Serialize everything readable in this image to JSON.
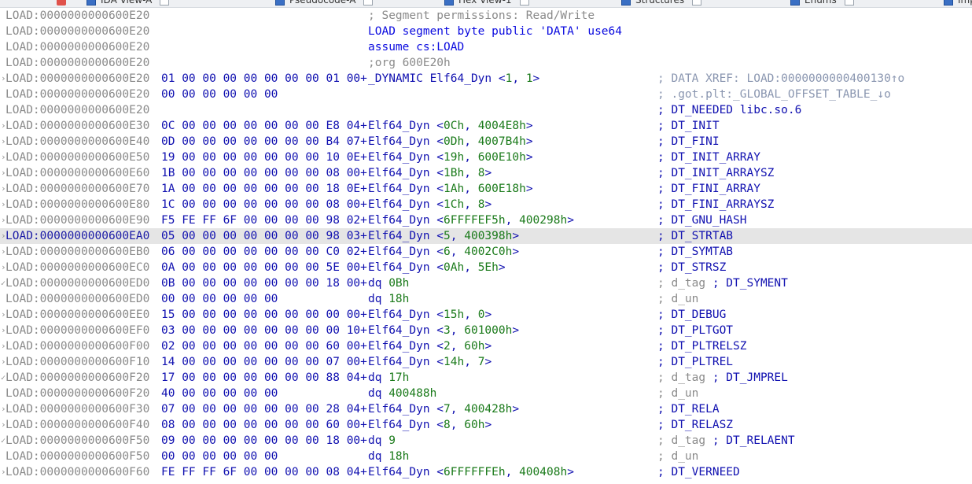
{
  "tabs": [
    {
      "label": "IDA View-A"
    },
    {
      "label": "Pseudocode-A"
    },
    {
      "label": "Hex View-1"
    },
    {
      "label": "Structures"
    },
    {
      "label": "Enums"
    },
    {
      "label": "Imports"
    }
  ],
  "rows": [
    {
      "addr": "LOAD:0000000000600E20",
      "mark": "",
      "bytes": "",
      "instr": [
        {
          "t": "; Segment permissions: Read/Write",
          "c": "gray"
        }
      ],
      "cmt": []
    },
    {
      "addr": "LOAD:0000000000600E20",
      "mark": "",
      "bytes": "",
      "instr": [
        {
          "t": "LOAD segment byte public 'DATA' use64",
          "c": "blue"
        }
      ],
      "cmt": []
    },
    {
      "addr": "LOAD:0000000000600E20",
      "mark": "",
      "bytes": "",
      "instr": [
        {
          "t": "assume cs:LOAD",
          "c": "blue"
        }
      ],
      "cmt": []
    },
    {
      "addr": "LOAD:0000000000600E20",
      "mark": "",
      "bytes": "",
      "instr": [
        {
          "t": ";org 600E20h",
          "c": "gray"
        }
      ],
      "cmt": []
    },
    {
      "addr": "LOAD:0000000000600E20",
      "mark": "tri",
      "bytes": "01 00 00 00 00 00 00 00 01 00+",
      "instr": [
        {
          "t": "_DYNAMIC Elf64_Dyn <",
          "c": "navy"
        },
        {
          "t": "1",
          "c": "green"
        },
        {
          "t": ", ",
          "c": "navy"
        },
        {
          "t": "1",
          "c": "green"
        },
        {
          "t": ">",
          "c": "navy"
        }
      ],
      "cmt": [
        {
          "t": "; DATA XREF: LOAD:0000000000400130↑o",
          "c": "muted"
        }
      ]
    },
    {
      "addr": "LOAD:0000000000600E20",
      "mark": "",
      "bytes": "00 00 00 00 00 00",
      "instr": [],
      "cmt": [
        {
          "t": "; .got.plt:_GLOBAL_OFFSET_TABLE_↓o",
          "c": "muted"
        }
      ]
    },
    {
      "addr": "LOAD:0000000000600E20",
      "mark": "",
      "bytes": "",
      "instr": [],
      "cmt": [
        {
          "t": "; DT_NEEDED libc.so.6",
          "c": "blue"
        }
      ]
    },
    {
      "addr": "LOAD:0000000000600E30",
      "mark": "tri",
      "bytes": "0C 00 00 00 00 00 00 00 E8 04+",
      "instr": [
        {
          "t": "Elf64_Dyn <",
          "c": "navy"
        },
        {
          "t": "0Ch",
          "c": "green"
        },
        {
          "t": ", ",
          "c": "navy"
        },
        {
          "t": "4004E8h",
          "c": "green"
        },
        {
          "t": ">",
          "c": "navy"
        }
      ],
      "cmt": [
        {
          "t": "; DT_INIT",
          "c": "blue"
        }
      ]
    },
    {
      "addr": "LOAD:0000000000600E40",
      "mark": "tri",
      "bytes": "0D 00 00 00 00 00 00 00 B4 07+",
      "instr": [
        {
          "t": "Elf64_Dyn <",
          "c": "navy"
        },
        {
          "t": "0Dh",
          "c": "green"
        },
        {
          "t": ", ",
          "c": "navy"
        },
        {
          "t": "4007B4h",
          "c": "green"
        },
        {
          "t": ">",
          "c": "navy"
        }
      ],
      "cmt": [
        {
          "t": "; DT_FINI",
          "c": "blue"
        }
      ]
    },
    {
      "addr": "LOAD:0000000000600E50",
      "mark": "tri",
      "bytes": "19 00 00 00 00 00 00 00 10 0E+",
      "instr": [
        {
          "t": "Elf64_Dyn <",
          "c": "navy"
        },
        {
          "t": "19h",
          "c": "green"
        },
        {
          "t": ", ",
          "c": "navy"
        },
        {
          "t": "600E10h",
          "c": "green"
        },
        {
          "t": ">",
          "c": "navy"
        }
      ],
      "cmt": [
        {
          "t": "; DT_INIT_ARRAY",
          "c": "blue"
        }
      ]
    },
    {
      "addr": "LOAD:0000000000600E60",
      "mark": "tri",
      "bytes": "1B 00 00 00 00 00 00 00 08 00+",
      "instr": [
        {
          "t": "Elf64_Dyn <",
          "c": "navy"
        },
        {
          "t": "1Bh",
          "c": "green"
        },
        {
          "t": ", ",
          "c": "navy"
        },
        {
          "t": "8",
          "c": "green"
        },
        {
          "t": ">",
          "c": "navy"
        }
      ],
      "cmt": [
        {
          "t": "; DT_INIT_ARRAYSZ",
          "c": "blue"
        }
      ]
    },
    {
      "addr": "LOAD:0000000000600E70",
      "mark": "tri",
      "bytes": "1A 00 00 00 00 00 00 00 18 0E+",
      "instr": [
        {
          "t": "Elf64_Dyn <",
          "c": "navy"
        },
        {
          "t": "1Ah",
          "c": "green"
        },
        {
          "t": ", ",
          "c": "navy"
        },
        {
          "t": "600E18h",
          "c": "green"
        },
        {
          "t": ">",
          "c": "navy"
        }
      ],
      "cmt": [
        {
          "t": "; DT_FINI_ARRAY",
          "c": "blue"
        }
      ]
    },
    {
      "addr": "LOAD:0000000000600E80",
      "mark": "tri",
      "bytes": "1C 00 00 00 00 00 00 00 08 00+",
      "instr": [
        {
          "t": "Elf64_Dyn <",
          "c": "navy"
        },
        {
          "t": "1Ch",
          "c": "green"
        },
        {
          "t": ", ",
          "c": "navy"
        },
        {
          "t": "8",
          "c": "green"
        },
        {
          "t": ">",
          "c": "navy"
        }
      ],
      "cmt": [
        {
          "t": "; DT_FINI_ARRAYSZ",
          "c": "blue"
        }
      ]
    },
    {
      "addr": "LOAD:0000000000600E90",
      "mark": "tri",
      "bytes": "F5 FE FF 6F 00 00 00 00 98 02+",
      "instr": [
        {
          "t": "Elf64_Dyn <",
          "c": "navy"
        },
        {
          "t": "6FFFFEF5h",
          "c": "green"
        },
        {
          "t": ", ",
          "c": "navy"
        },
        {
          "t": "400298h",
          "c": "green"
        },
        {
          "t": ">",
          "c": "navy"
        }
      ],
      "cmt": [
        {
          "t": "; DT_GNU_HASH",
          "c": "blue"
        }
      ]
    },
    {
      "addr": "LOAD:0000000000600EA0",
      "mark": "tri",
      "hl": true,
      "bytes": "05 00 00 00 00 00 00 00 98 03+",
      "instr": [
        {
          "t": "Elf64_Dyn <",
          "c": "navy"
        },
        {
          "t": "5",
          "c": "green"
        },
        {
          "t": ", ",
          "c": "navy"
        },
        {
          "t": "400398h",
          "c": "green"
        },
        {
          "t": ">",
          "c": "navy"
        }
      ],
      "cmt": [
        {
          "t": "; DT_STRTAB",
          "c": "blue"
        }
      ]
    },
    {
      "addr": "LOAD:0000000000600EB0",
      "mark": "tri",
      "bytes": "06 00 00 00 00 00 00 00 C0 02+",
      "instr": [
        {
          "t": "Elf64_Dyn <",
          "c": "navy"
        },
        {
          "t": "6",
          "c": "green"
        },
        {
          "t": ", ",
          "c": "navy"
        },
        {
          "t": "4002C0h",
          "c": "green"
        },
        {
          "t": ">",
          "c": "navy"
        }
      ],
      "cmt": [
        {
          "t": "; DT_SYMTAB",
          "c": "blue"
        }
      ]
    },
    {
      "addr": "LOAD:0000000000600EC0",
      "mark": "tri",
      "bytes": "0A 00 00 00 00 00 00 00 5E 00+",
      "instr": [
        {
          "t": "Elf64_Dyn <",
          "c": "navy"
        },
        {
          "t": "0Ah",
          "c": "green"
        },
        {
          "t": ", ",
          "c": "navy"
        },
        {
          "t": "5Eh",
          "c": "green"
        },
        {
          "t": ">",
          "c": "navy"
        }
      ],
      "cmt": [
        {
          "t": "; DT_STRSZ",
          "c": "blue"
        }
      ]
    },
    {
      "addr": "LOAD:0000000000600ED0",
      "mark": "chk",
      "bytes": "0B 00 00 00 00 00 00 00 18 00+",
      "instr": [
        {
          "t": "dq ",
          "c": "navy"
        },
        {
          "t": "0Bh",
          "c": "green"
        }
      ],
      "cmt": [
        {
          "t": "; d_tag ",
          "c": "gray"
        },
        {
          "t": "; DT_SYMENT",
          "c": "blue"
        }
      ]
    },
    {
      "addr": "LOAD:0000000000600ED0",
      "mark": "",
      "bytes": "00 00 00 00 00 00",
      "instr": [
        {
          "t": "dq ",
          "c": "navy"
        },
        {
          "t": "18h",
          "c": "green"
        }
      ],
      "cmt": [
        {
          "t": "; d_un",
          "c": "gray"
        }
      ]
    },
    {
      "addr": "LOAD:0000000000600EE0",
      "mark": "tri",
      "bytes": "15 00 00 00 00 00 00 00 00 00+",
      "instr": [
        {
          "t": "Elf64_Dyn <",
          "c": "navy"
        },
        {
          "t": "15h",
          "c": "green"
        },
        {
          "t": ", ",
          "c": "navy"
        },
        {
          "t": "0",
          "c": "green"
        },
        {
          "t": ">",
          "c": "navy"
        }
      ],
      "cmt": [
        {
          "t": "; DT_DEBUG",
          "c": "blue"
        }
      ]
    },
    {
      "addr": "LOAD:0000000000600EF0",
      "mark": "tri",
      "bytes": "03 00 00 00 00 00 00 00 00 10+",
      "instr": [
        {
          "t": "Elf64_Dyn <",
          "c": "navy"
        },
        {
          "t": "3",
          "c": "green"
        },
        {
          "t": ", ",
          "c": "navy"
        },
        {
          "t": "601000h",
          "c": "green"
        },
        {
          "t": ">",
          "c": "navy"
        }
      ],
      "cmt": [
        {
          "t": "; DT_PLTGOT",
          "c": "blue"
        }
      ]
    },
    {
      "addr": "LOAD:0000000000600F00",
      "mark": "tri",
      "bytes": "02 00 00 00 00 00 00 00 60 00+",
      "instr": [
        {
          "t": "Elf64_Dyn <",
          "c": "navy"
        },
        {
          "t": "2",
          "c": "green"
        },
        {
          "t": ", ",
          "c": "navy"
        },
        {
          "t": "60h",
          "c": "green"
        },
        {
          "t": ">",
          "c": "navy"
        }
      ],
      "cmt": [
        {
          "t": "; DT_PLTRELSZ",
          "c": "blue"
        }
      ]
    },
    {
      "addr": "LOAD:0000000000600F10",
      "mark": "tri",
      "bytes": "14 00 00 00 00 00 00 00 07 00+",
      "instr": [
        {
          "t": "Elf64_Dyn <",
          "c": "navy"
        },
        {
          "t": "14h",
          "c": "green"
        },
        {
          "t": ", ",
          "c": "navy"
        },
        {
          "t": "7",
          "c": "green"
        },
        {
          "t": ">",
          "c": "navy"
        }
      ],
      "cmt": [
        {
          "t": "; DT_PLTREL",
          "c": "blue"
        }
      ]
    },
    {
      "addr": "LOAD:0000000000600F20",
      "mark": "chk",
      "bytes": "17 00 00 00 00 00 00 00 88 04+",
      "instr": [
        {
          "t": "dq ",
          "c": "navy"
        },
        {
          "t": "17h",
          "c": "green"
        }
      ],
      "cmt": [
        {
          "t": "; d_tag ",
          "c": "gray"
        },
        {
          "t": "; DT_JMPREL",
          "c": "blue"
        }
      ]
    },
    {
      "addr": "LOAD:0000000000600F20",
      "mark": "",
      "bytes": "40 00 00 00 00 00",
      "instr": [
        {
          "t": "dq ",
          "c": "navy"
        },
        {
          "t": "400488h",
          "c": "green"
        }
      ],
      "cmt": [
        {
          "t": "; d_un",
          "c": "gray"
        }
      ]
    },
    {
      "addr": "LOAD:0000000000600F30",
      "mark": "tri",
      "bytes": "07 00 00 00 00 00 00 00 28 04+",
      "instr": [
        {
          "t": "Elf64_Dyn <",
          "c": "navy"
        },
        {
          "t": "7",
          "c": "green"
        },
        {
          "t": ", ",
          "c": "navy"
        },
        {
          "t": "400428h",
          "c": "green"
        },
        {
          "t": ">",
          "c": "navy"
        }
      ],
      "cmt": [
        {
          "t": "; DT_RELA",
          "c": "blue"
        }
      ]
    },
    {
      "addr": "LOAD:0000000000600F40",
      "mark": "tri",
      "bytes": "08 00 00 00 00 00 00 00 60 00+",
      "instr": [
        {
          "t": "Elf64_Dyn <",
          "c": "navy"
        },
        {
          "t": "8",
          "c": "green"
        },
        {
          "t": ", ",
          "c": "navy"
        },
        {
          "t": "60h",
          "c": "green"
        },
        {
          "t": ">",
          "c": "navy"
        }
      ],
      "cmt": [
        {
          "t": "; DT_RELASZ",
          "c": "blue"
        }
      ]
    },
    {
      "addr": "LOAD:0000000000600F50",
      "mark": "chk",
      "bytes": "09 00 00 00 00 00 00 00 18 00+",
      "instr": [
        {
          "t": "dq ",
          "c": "navy"
        },
        {
          "t": "9",
          "c": "green"
        }
      ],
      "cmt": [
        {
          "t": "; d_tag ",
          "c": "gray"
        },
        {
          "t": "; DT_RELAENT",
          "c": "blue"
        }
      ]
    },
    {
      "addr": "LOAD:0000000000600F50",
      "mark": "",
      "bytes": "00 00 00 00 00 00",
      "instr": [
        {
          "t": "dq ",
          "c": "navy"
        },
        {
          "t": "18h",
          "c": "green"
        }
      ],
      "cmt": [
        {
          "t": "; d_un",
          "c": "gray"
        }
      ]
    },
    {
      "addr": "LOAD:0000000000600F60",
      "mark": "tri",
      "bytes": "FE FF FF 6F 00 00 00 00 08 04+",
      "instr": [
        {
          "t": "Elf64_Dyn <",
          "c": "navy"
        },
        {
          "t": "6FFFFFFEh",
          "c": "green"
        },
        {
          "t": ", ",
          "c": "navy"
        },
        {
          "t": "400408h",
          "c": "green"
        },
        {
          "t": ">",
          "c": "navy"
        }
      ],
      "cmt": [
        {
          "t": "; DT_VERNEED",
          "c": "blue"
        }
      ]
    }
  ],
  "colors": {
    "keyword": "#0a0adf",
    "operand": "#1a7a1a",
    "comment": "#8a8a8a",
    "struct": "#1010b0",
    "highlight_row": "#e5e5e5"
  }
}
